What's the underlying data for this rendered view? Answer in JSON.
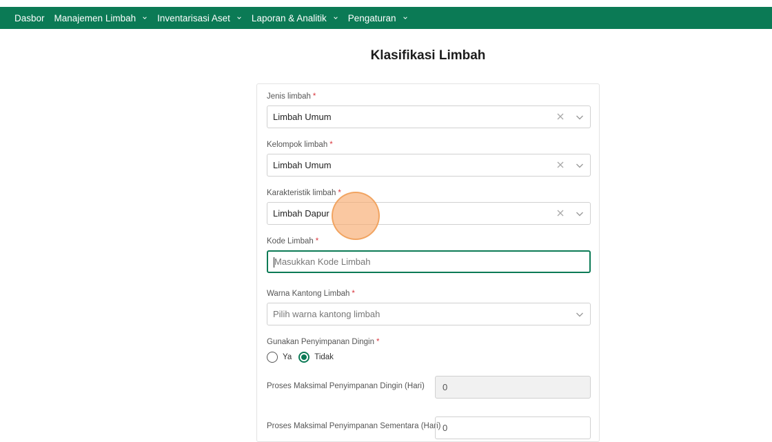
{
  "nav": {
    "items": [
      {
        "label": "Dasbor",
        "dropdown": false
      },
      {
        "label": "Manajemen Limbah",
        "dropdown": true
      },
      {
        "label": "Inventarisasi Aset",
        "dropdown": true
      },
      {
        "label": "Laporan & Analitik",
        "dropdown": true
      },
      {
        "label": "Pengaturan",
        "dropdown": true
      }
    ],
    "color": "#0b7a55"
  },
  "page": {
    "title": "Klasifikasi Limbah"
  },
  "form": {
    "jenis": {
      "label": "Jenis limbah",
      "required": "*",
      "value": "Limbah Umum"
    },
    "kelompok": {
      "label": "Kelompok limbah",
      "required": "*",
      "value": "Limbah Umum"
    },
    "karakteristik": {
      "label": "Karakteristik limbah",
      "required": "*",
      "value": "Limbah Dapur"
    },
    "kode": {
      "label": "Kode Limbah",
      "required": "*",
      "placeholder": "Masukkan Kode Limbah",
      "value": ""
    },
    "warna": {
      "label": "Warna Kantong Limbah",
      "required": "*",
      "placeholder": "Pilih warna kantong limbah"
    },
    "dingin": {
      "label": "Gunakan Penyimpanan Dingin",
      "required": "*",
      "options": [
        "Ya",
        "Tidak"
      ],
      "selected": "Tidak"
    },
    "proses_dingin": {
      "label": "Proses Maksimal Penyimpanan Dingin (Hari)",
      "value": "0",
      "disabled": true
    },
    "proses_sementara": {
      "label": "Proses Maksimal Penyimpanan Sementara (Hari)",
      "value": "0"
    }
  },
  "icons": {
    "clear": "close-icon",
    "dropdown": "chevron-down-icon"
  }
}
